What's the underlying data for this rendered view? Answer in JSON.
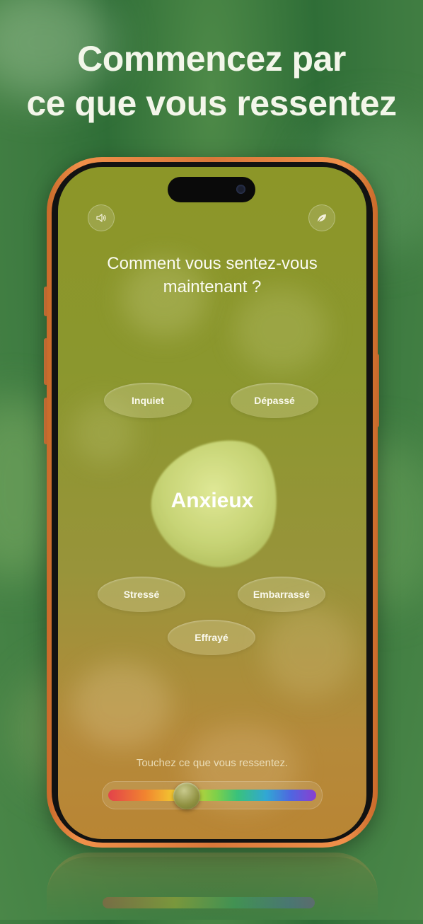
{
  "headline": {
    "line1": "Commencez par",
    "line2": "ce que vous ressentez"
  },
  "screen": {
    "sound_icon": "speaker-icon",
    "leaf_icon": "leaf-icon",
    "question_line1": "Comment vous sentez-vous",
    "question_line2": "maintenant ?",
    "selected_emotion": "Anxieux",
    "emotions": {
      "inquiet": "Inquiet",
      "depasse": "Dépassé",
      "stresse": "Stressé",
      "embarrasse": "Embarrassé",
      "effraye": "Effrayé"
    },
    "hint": "Touchez ce que vous ressentez.",
    "slider": {
      "position": 0.38,
      "colors": [
        "#e3424a",
        "#f1852f",
        "#f2d431",
        "#7dd04a",
        "#39c27b",
        "#31a7d4",
        "#5065e0",
        "#8a3fd0"
      ]
    }
  },
  "colors": {
    "background_green": "#2f6e37",
    "phone_frame": "#e07e3c",
    "screen_top": "#8c9628",
    "screen_bottom": "#b98534",
    "emotion_shape": "#d6e28c"
  }
}
